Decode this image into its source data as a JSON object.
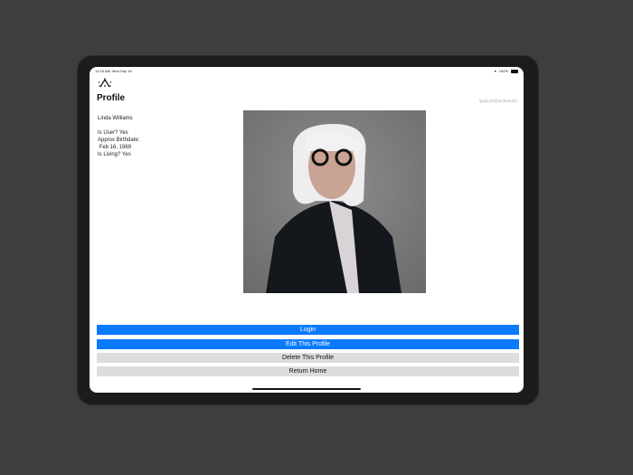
{
  "status_bar": {
    "time": "12:15 AM",
    "date": "Mon Sep 16",
    "battery": "100%"
  },
  "header": {
    "title": "Profile",
    "account_email": "ipad129@archive.life"
  },
  "profile": {
    "name": "Linda Williams",
    "is_user": "Is User? Yes",
    "birthdate_label": "Approx Birthdate:",
    "birthdate": " Feb 16, 1969",
    "is_living": "Is Living? Yes"
  },
  "buttons": {
    "login": "Login",
    "edit": "Edit This Profile",
    "delete": "Delete This Profile",
    "home": "Return Home"
  },
  "colors": {
    "accent": "#0a7aff",
    "secondary": "#dddddd"
  }
}
